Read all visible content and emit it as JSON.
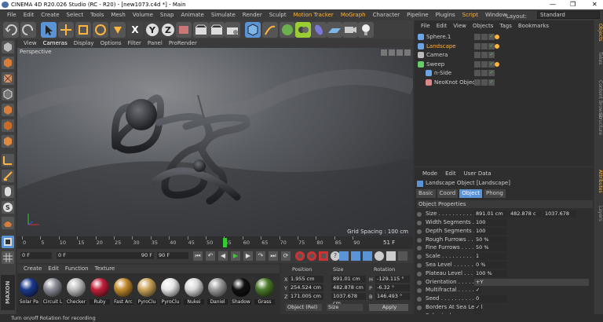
{
  "title": "CINEMA 4D R20.026 Studio (RC - R20) - [new1073.c4d *] - Main",
  "menubar": [
    "File",
    "Edit",
    "Create",
    "Select",
    "Tools",
    "Mesh",
    "Volume",
    "Snap",
    "Animate",
    "Simulate",
    "Render",
    "Sculpt",
    "Motion Tracker",
    "MoGraph",
    "Character",
    "Pipeline",
    "Plugins",
    "Script",
    "Window"
  ],
  "layout": {
    "label": "Layout:",
    "value": "Standard"
  },
  "viewport": {
    "menu": [
      "View",
      "Cameras",
      "Display",
      "Options",
      "Filter",
      "Panel",
      "ProRender"
    ],
    "label": "Perspective",
    "grid_spacing": "Grid Spacing : 100 cm"
  },
  "timeline": {
    "ticks": [
      "0",
      "5",
      "10",
      "15",
      "20",
      "25",
      "30",
      "35",
      "40",
      "45",
      "50",
      "55",
      "60",
      "65",
      "70",
      "75",
      "80",
      "85",
      "90"
    ],
    "current_frame": "51",
    "end_frame": "51 F"
  },
  "playbar": {
    "start": "0 F",
    "field": "0 F",
    "max": "90 F",
    "end": "90 F"
  },
  "materials": {
    "menu": [
      "Create",
      "Edit",
      "Function",
      "Texture"
    ],
    "items": [
      {
        "name": "Solar Pa",
        "color": "#1b3a8c"
      },
      {
        "name": "Circuit L",
        "color": "#8a8d96"
      },
      {
        "name": "Checker",
        "color": "#bdbdbd"
      },
      {
        "name": "Ruby",
        "color": "#c0203a"
      },
      {
        "name": "Fast Arc",
        "color": "#c08a2e"
      },
      {
        "name": "PyroClu",
        "color": "#c9a35a"
      },
      {
        "name": "PyroClu",
        "color": "#e6e6e6"
      },
      {
        "name": "Nukei",
        "color": "#d8d8d8"
      },
      {
        "name": "Daniel",
        "color": "#9a9a9a"
      },
      {
        "name": "Shadow",
        "color": "#111111"
      },
      {
        "name": "Grass",
        "color": "#4b7a2a"
      }
    ]
  },
  "coordinates": {
    "headers": [
      "Position",
      "Size",
      "Rotation"
    ],
    "rows": [
      {
        "axis": "X",
        "pos": "1.955 cm",
        "size": "891.01 cm",
        "rot_axis": "H",
        "rot": "-129.115 °"
      },
      {
        "axis": "Y",
        "pos": "254.524 cm",
        "size": "482.878 cm",
        "rot_axis": "P",
        "rot": "-6.32 °"
      },
      {
        "axis": "Z",
        "pos": "171.005 cm",
        "size": "1037.678 cm",
        "rot_axis": "B",
        "rot": "146.493 °"
      }
    ],
    "mode": "Object (Rel)",
    "size_mode": "Size",
    "apply": "Apply"
  },
  "object_manager": {
    "menu": [
      "File",
      "Edit",
      "View",
      "Objects",
      "Tags",
      "Bookmarks"
    ],
    "objects": [
      {
        "name": "Sphere.1",
        "indent": 0,
        "icon": "sphere-icon",
        "selected": false
      },
      {
        "name": "Landscape",
        "indent": 0,
        "icon": "landscape-icon",
        "selected": true
      },
      {
        "name": "Camera",
        "indent": 0,
        "icon": "camera-icon",
        "selected": false
      },
      {
        "name": "Sweep",
        "indent": 0,
        "icon": "sweep-icon",
        "selected": false
      },
      {
        "name": "n-Side",
        "indent": 1,
        "icon": "nside-icon",
        "selected": false
      },
      {
        "name": "NeoKnot Object",
        "indent": 1,
        "icon": "knot-icon",
        "selected": false
      }
    ]
  },
  "attributes": {
    "menu": [
      "Mode",
      "Edit",
      "User Data"
    ],
    "object_title": "Landscape Object [Landscape]",
    "tabs": [
      "Basic",
      "Coord",
      "Object",
      "Phong"
    ],
    "active_tab": "Object",
    "section": "Object Properties",
    "size": {
      "label": "Size . . . . . . . . . . . . .",
      "x": "891.01 cm",
      "y": "482.878 c",
      "z": "1037.678"
    },
    "props": [
      {
        "label": "Width Segments . . .",
        "value": "100"
      },
      {
        "label": "Depth Segments . . .",
        "value": "100"
      },
      {
        "label": "Rough Furrows . . .",
        "value": "50 %"
      },
      {
        "label": "Fine Furrows . . . . .",
        "value": "50 %"
      },
      {
        "label": "Scale . . . . . . . . . .",
        "value": "1"
      },
      {
        "label": "Sea Level . . . . . . .",
        "value": "0 %"
      },
      {
        "label": "Plateau Level . . . .",
        "value": "100 %"
      },
      {
        "label": "Orientation . . . . . .",
        "value": "+Y"
      },
      {
        "label": "Multifractal . . . . . .",
        "value": "✓"
      },
      {
        "label": "Seed . . . . . . . . . . .",
        "value": "0"
      },
      {
        "label": "Borders At Sea Level",
        "value": "✓"
      },
      {
        "label": "Spherical . . . . . . . .",
        "value": ""
      }
    ]
  },
  "side_tabs": [
    "Objects",
    "Takes",
    "Content Browser",
    "Structure",
    "Attributes",
    "Layers"
  ],
  "status": "Turn on/off Rotation for recording",
  "colors": {
    "accent": "#ffb43c",
    "select_blue": "#5a93d6",
    "bg": "#333333"
  }
}
